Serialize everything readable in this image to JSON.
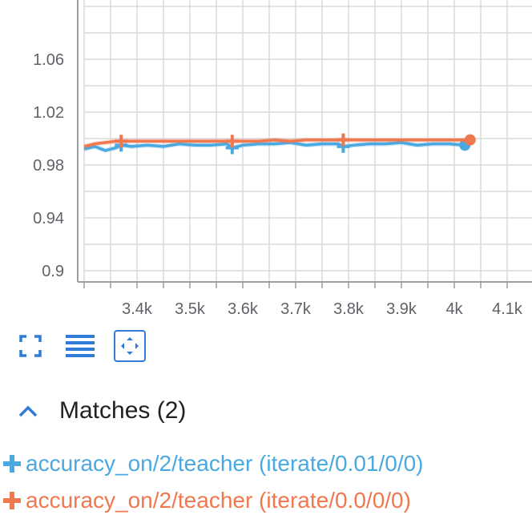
{
  "chart_data": {
    "type": "line",
    "title": "",
    "xlabel": "",
    "ylabel": "",
    "xlim": [
      3300,
      4150
    ],
    "ylim": [
      0.88,
      1.1
    ],
    "grid": true,
    "x_ticks": [
      3400,
      3500,
      3600,
      3700,
      3800,
      3900,
      4000,
      4100
    ],
    "x_tick_labels": [
      "3.4k",
      "3.5k",
      "3.6k",
      "3.7k",
      "3.8k",
      "3.9k",
      "4k",
      "4.1k"
    ],
    "y_ticks": [
      0.9,
      0.94,
      0.98,
      1.02,
      1.06
    ],
    "y_tick_labels": [
      "0.9",
      "0.94",
      "0.98",
      "1.02",
      "1.06"
    ],
    "series": [
      {
        "name": "accuracy_on/2/teacher (iterate/0.01/0/0)",
        "color": "#4aa9e0",
        "x": [
          3300,
          3320,
          3340,
          3360,
          3370,
          3390,
          3420,
          3450,
          3480,
          3510,
          3540,
          3570,
          3580,
          3600,
          3630,
          3660,
          3690,
          3720,
          3750,
          3780,
          3790,
          3810,
          3840,
          3870,
          3900,
          3930,
          3960,
          3990,
          4020
        ],
        "y": [
          0.992,
          0.994,
          0.991,
          0.993,
          0.995,
          0.994,
          0.995,
          0.994,
          0.996,
          0.995,
          0.995,
          0.996,
          0.993,
          0.995,
          0.996,
          0.996,
          0.997,
          0.995,
          0.996,
          0.996,
          0.994,
          0.995,
          0.996,
          0.996,
          0.997,
          0.995,
          0.996,
          0.996,
          0.995
        ],
        "markers_x": [
          3370,
          3580,
          3790
        ],
        "last_point": [
          4020,
          0.995
        ]
      },
      {
        "name": "accuracy_on/2/teacher (iterate/0.0/0/0)",
        "color": "#f0784f",
        "x": [
          3300,
          3320,
          3340,
          3360,
          3370,
          3390,
          3420,
          3450,
          3480,
          3510,
          3540,
          3570,
          3580,
          3600,
          3630,
          3660,
          3690,
          3720,
          3750,
          3780,
          3790,
          3810,
          3840,
          3870,
          3900,
          3930,
          3960,
          3990,
          4030
        ],
        "y": [
          0.994,
          0.996,
          0.997,
          0.998,
          0.998,
          0.998,
          0.998,
          0.998,
          0.998,
          0.998,
          0.998,
          0.998,
          0.998,
          0.998,
          0.998,
          0.999,
          0.998,
          0.999,
          0.999,
          0.999,
          0.999,
          0.999,
          0.999,
          0.999,
          0.999,
          0.999,
          0.999,
          0.999,
          0.999
        ],
        "markers_x": [
          3370,
          3580,
          3790
        ],
        "last_point": [
          4030,
          0.999
        ]
      }
    ]
  },
  "toolbar": {
    "icons": [
      "fullscreen-icon",
      "lines-icon",
      "fit-domain-icon"
    ]
  },
  "matches": {
    "title": "Matches (2)",
    "collapse_icon": "chevron-up-icon",
    "items": [
      {
        "label": "accuracy_on/2/teacher (iterate/0.01/0/0)",
        "color": "#4aa9e0",
        "icon": "plus-icon"
      },
      {
        "label": "accuracy_on/2/teacher (iterate/0.0/0/0)",
        "color": "#f0784f",
        "icon": "plus-icon"
      }
    ]
  }
}
